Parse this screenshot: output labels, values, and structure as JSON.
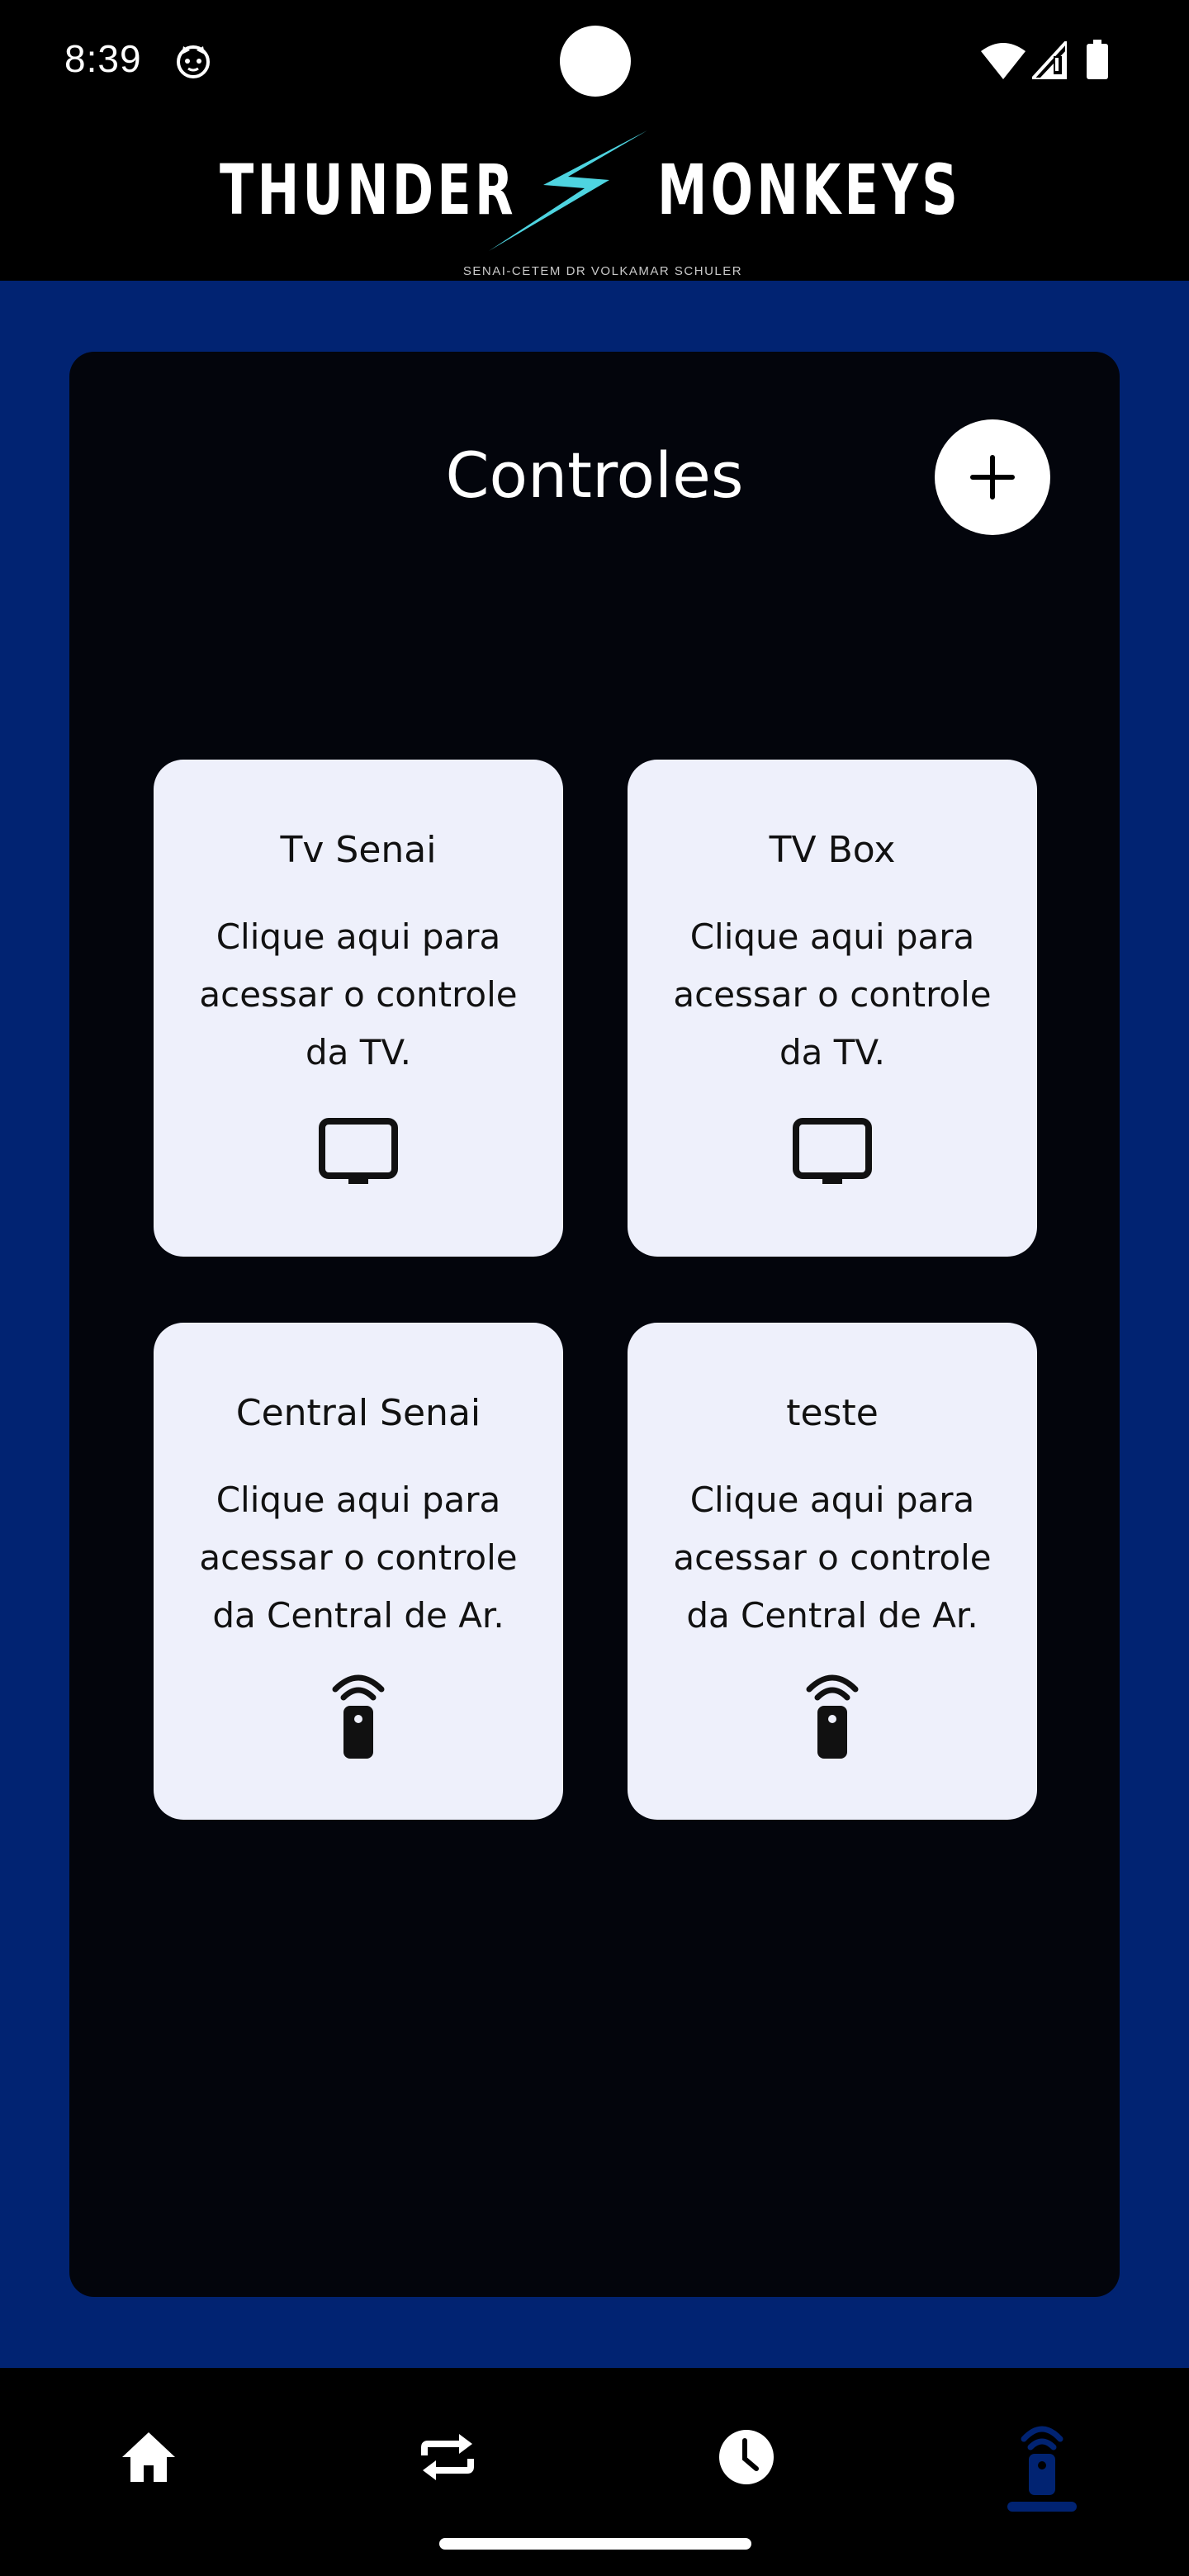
{
  "status_bar": {
    "time": "8:39",
    "app_icon": "cat-face-icon",
    "wifi_icon": "wifi-icon",
    "signal_icon": "cell-signal-icon",
    "battery_icon": "battery-icon"
  },
  "header": {
    "logo_left": "THUNDER",
    "logo_right": "MONKEYS",
    "logo_subtitle": "SENAI-CETEM DR VOLKAMAR SCHULER",
    "logout_icon": "logout-icon",
    "bolt_color": "#4ed4e0"
  },
  "panel": {
    "title": "Controles",
    "add_icon": "plus-icon"
  },
  "cards": [
    {
      "title": "Tv Senai",
      "desc": "Clique aqui para acessar o controle da TV.",
      "icon": "tv-icon"
    },
    {
      "title": "TV Box",
      "desc": "Clique aqui para acessar o controle da TV.",
      "icon": "tv-icon"
    },
    {
      "title": "Central Senai",
      "desc": "Clique aqui para acessar o controle da Central de Ar.",
      "icon": "remote-control-icon"
    },
    {
      "title": "teste",
      "desc": "Clique aqui para acessar o controle da Central de Ar.",
      "icon": "remote-control-icon"
    }
  ],
  "bottom_nav": {
    "items": [
      {
        "icon": "home-icon",
        "active": false
      },
      {
        "icon": "repeat-icon",
        "active": false
      },
      {
        "icon": "clock-icon",
        "active": false
      },
      {
        "icon": "remote-control-icon",
        "active": true
      }
    ]
  },
  "colors": {
    "background_blue": "#012372",
    "panel": "#03050c",
    "card": "#eef0fb",
    "accent_cyan": "#4ed4e0"
  }
}
